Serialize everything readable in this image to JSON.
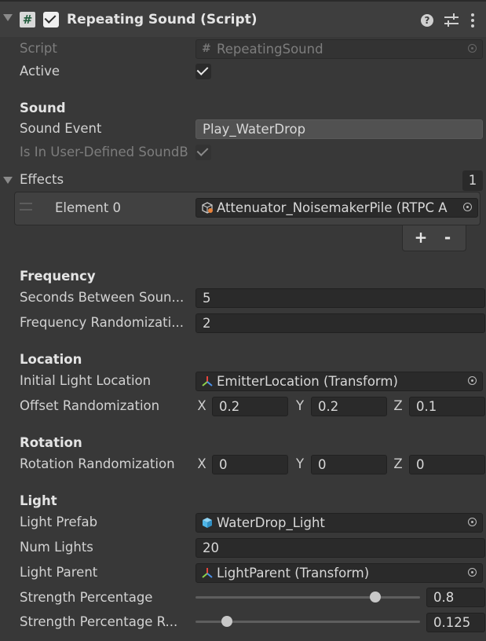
{
  "component": {
    "title": "Repeating Sound (Script)",
    "enabled": true,
    "icons": {
      "script": "hash-script-icon",
      "help": "help-icon",
      "presets": "presets-sliders-icon",
      "more": "more-vertical-icon"
    }
  },
  "fields": {
    "script": {
      "label": "Script",
      "value": "RepeatingSound"
    },
    "active": {
      "label": "Active",
      "checked": true
    }
  },
  "sections": {
    "sound": "Sound",
    "frequency": "Frequency",
    "location": "Location",
    "rotation": "Rotation",
    "light": "Light"
  },
  "sound": {
    "event_label": "Sound Event",
    "event_value": "Play_WaterDrop",
    "user_defined_label": "Is In User-Defined SoundB",
    "user_defined_checked": true
  },
  "effects": {
    "label": "Effects",
    "count": "1",
    "elements": [
      {
        "label": "Element 0",
        "value": "Attenuator_NoisemakerPile (RTPC A"
      }
    ],
    "add": "+",
    "remove": "-"
  },
  "frequency": {
    "seconds_label": "Seconds Between Soun...",
    "seconds_value": "5",
    "random_label": "Frequency Randomizati...",
    "random_value": "2"
  },
  "location": {
    "initial_label": "Initial Light Location",
    "initial_value": "EmitterLocation (Transform)",
    "offset_label": "Offset Randomization",
    "offset": {
      "x_label": "X",
      "x": "0.2",
      "y_label": "Y",
      "y": "0.2",
      "z_label": "Z",
      "z": "0.1"
    }
  },
  "rotation": {
    "random_label": "Rotation Randomization",
    "random": {
      "x_label": "X",
      "x": "0",
      "y_label": "Y",
      "y": "0",
      "z_label": "Z",
      "z": "0"
    }
  },
  "light": {
    "prefab_label": "Light Prefab",
    "prefab_value": "WaterDrop_Light",
    "num_label": "Num Lights",
    "num_value": "20",
    "parent_label": "Light Parent",
    "parent_value": "LightParent (Transform)",
    "strength_label": "Strength Percentage",
    "strength_value": "0.8",
    "strength_fraction": 0.8,
    "strength_r_label": "Strength Percentage R...",
    "strength_r_value": "0.125",
    "strength_r_fraction": 0.14
  },
  "colors": {
    "background": "#383838",
    "field": "#2a2a2a",
    "prefab_cube": "#4fb6e8",
    "transform_red": "#e8453c",
    "transform_green": "#8ed14b",
    "transform_blue": "#4a8fe8",
    "audio_orange": "#e8823a"
  }
}
